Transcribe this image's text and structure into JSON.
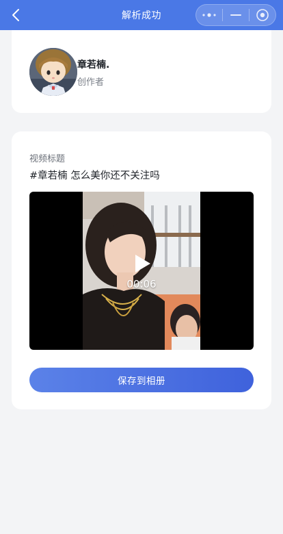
{
  "header": {
    "title": "解析成功",
    "back_icon": "chevron-left-icon",
    "menu_icon": "more-dots-icon",
    "minimize_icon": "minimize-icon",
    "close_icon": "target-circle-icon",
    "color": "#4a78e6"
  },
  "author": {
    "name": "章若楠.",
    "role": "创作者"
  },
  "video": {
    "title_label": "视频标题",
    "title": "#章若楠 怎么美你还不关注吗",
    "duration": "00:06",
    "play_icon": "play-icon"
  },
  "actions": {
    "save_label": "保存到相册",
    "accent": "#4a6fe0"
  }
}
